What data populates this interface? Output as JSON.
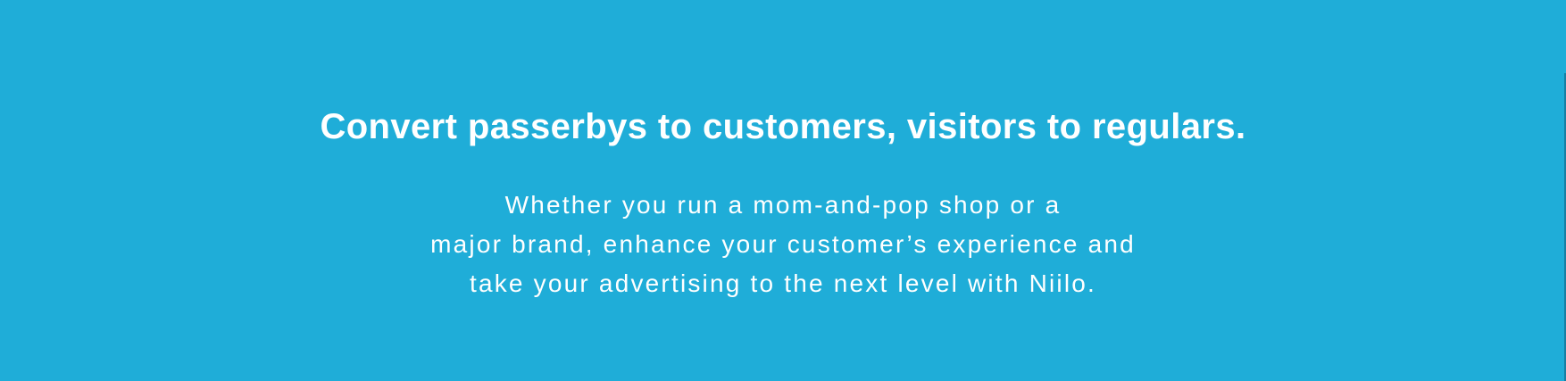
{
  "colors": {
    "background": "#1fadd8",
    "text": "#ffffff"
  },
  "hero": {
    "headline": "Convert passerbys to customers, visitors to regulars.",
    "body_lines": [
      "Whether you run a mom-and-pop shop or a",
      "major brand, enhance your customer’s experience and",
      "take your advertising to the next level with Niilo."
    ]
  }
}
